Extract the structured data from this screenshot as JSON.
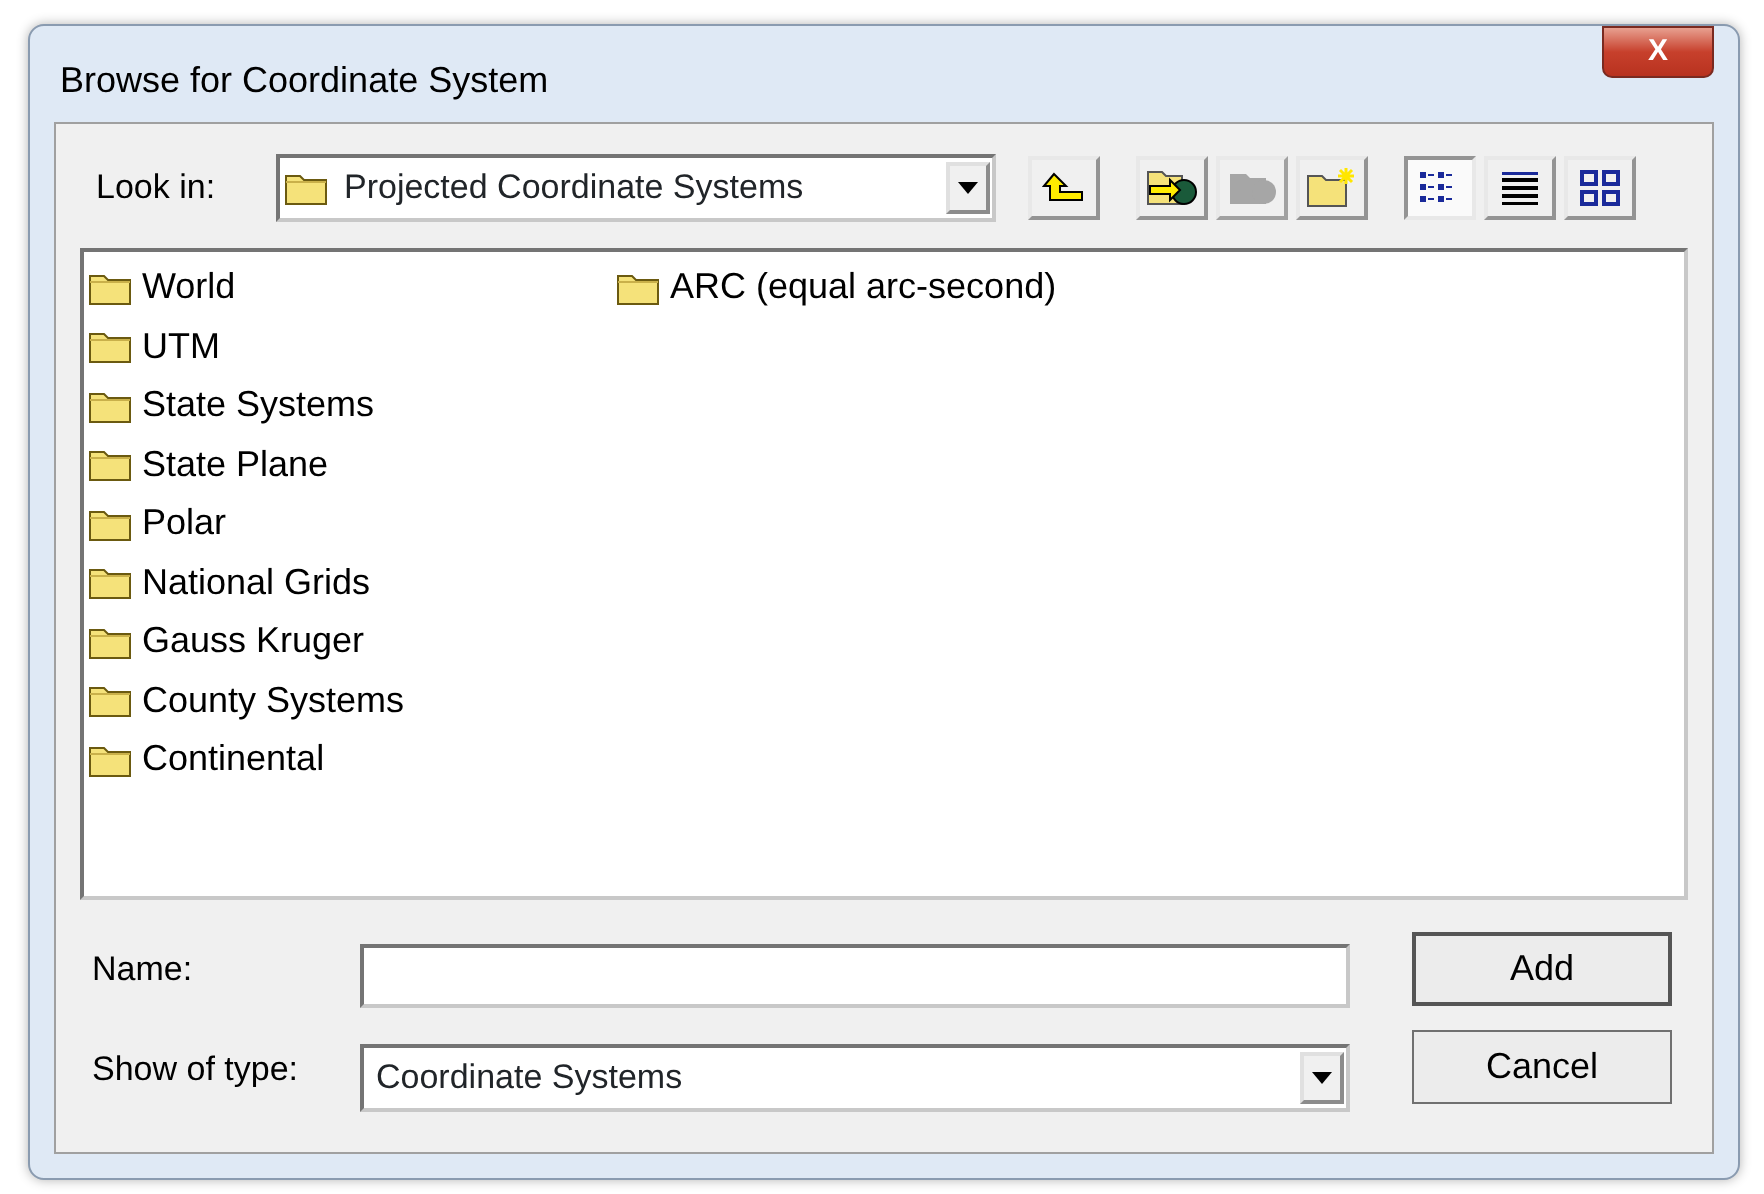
{
  "window": {
    "title": "Browse for Coordinate System",
    "close_symbol": "X"
  },
  "look_in": {
    "label": "Look in:",
    "value": "Projected Coordinate Systems"
  },
  "toolbar": [
    {
      "kind": "up",
      "disabled": false
    },
    {
      "kind": "connect",
      "disabled": false
    },
    {
      "kind": "disconnect",
      "disabled": true
    },
    {
      "kind": "newfolder",
      "disabled": false
    }
  ],
  "views": [
    {
      "kind": "list",
      "selected": true
    },
    {
      "kind": "details",
      "selected": false
    },
    {
      "kind": "icons",
      "selected": false
    }
  ],
  "items": [
    {
      "name": "World"
    },
    {
      "name": "UTM"
    },
    {
      "name": "State Systems"
    },
    {
      "name": "State Plane"
    },
    {
      "name": "Polar"
    },
    {
      "name": "National Grids"
    },
    {
      "name": "Gauss Kruger"
    },
    {
      "name": "County Systems"
    },
    {
      "name": "Continental"
    },
    {
      "name": "ARC (equal arc-second)"
    }
  ],
  "name_field": {
    "label": "Name:"
  },
  "type_field": {
    "label": "Show of type:",
    "value": "Coordinate Systems"
  },
  "buttons": [
    {
      "label": "Add",
      "default": true
    },
    {
      "label": "Cancel",
      "default": false
    }
  ]
}
